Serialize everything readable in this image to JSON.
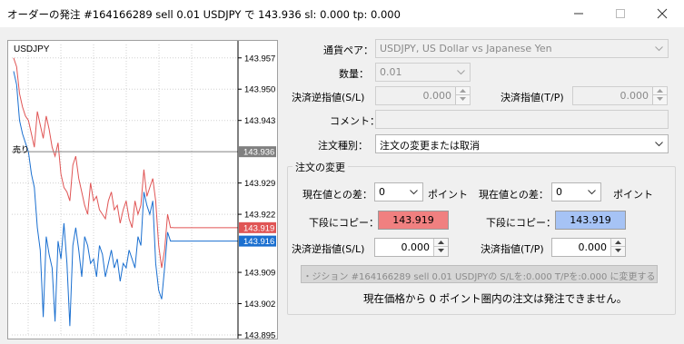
{
  "window": {
    "title": "オーダーの発注 #164166289 sell 0.01 USDJPY で 143.936 sl: 0.000 tp: 0.000"
  },
  "chart": {
    "symbol": "USDJPY",
    "axis_labels": [
      "143.957",
      "143.950",
      "143.943",
      "143.929",
      "143.922",
      "143.909",
      "143.902",
      "143.895"
    ],
    "current_price_tag": "143.936",
    "ask_tag": "143.919",
    "bid_tag": "143.916",
    "order_line_label": "売り"
  },
  "form": {
    "symbol_label": "通貨ペア：",
    "symbol_value": "USDJPY, US Dollar vs Japanese Yen",
    "volume_label": "数量：",
    "volume_value": "0.01",
    "sl_label": "決済逆指値(S/L)",
    "sl_value": "0.000",
    "tp_label": "決済指値(T/P)",
    "tp_value": "0.000",
    "comment_label": "コメント：",
    "comment_value": "",
    "type_label": "注文種別：",
    "type_value": "注文の変更または取消"
  },
  "modify": {
    "group_title": "注文の変更",
    "left": {
      "diff_label": "現在値との差：",
      "diff_value": "0",
      "points": "ポイント",
      "copy_label": "下段にコピー：",
      "copy_value": "143.919",
      "sl_label": "決済逆指値(S/L)",
      "sl_value": "0.000"
    },
    "right": {
      "diff_label": "現在値との差：",
      "diff_value": "0",
      "points": "ポイント",
      "copy_label": "下段にコピー：",
      "copy_value": "143.919",
      "tp_label": "決済指値(T/P)",
      "tp_value": "0.000"
    },
    "modify_button": "・ジション #164166289 sell 0.01 USDJPYの S/Lを:0.000 T/Pを:0.000 に変更する",
    "notice": "現在価格から 0 ポイント圏内の注文は発注できません。"
  },
  "colors": {
    "ask_line": "#e05555",
    "bid_line": "#1a6fd0",
    "ask_button": "#f08080",
    "bid_button": "#a6c3f5"
  },
  "chart_data": {
    "type": "line",
    "series": [
      {
        "values": [
          143.957,
          143.955,
          143.949,
          143.946,
          143.944,
          143.943,
          143.94,
          143.937,
          143.945,
          143.942,
          143.939,
          143.944,
          143.941,
          143.937,
          143.935,
          143.938,
          143.931,
          143.928,
          143.927,
          143.925,
          143.933,
          143.935,
          143.93,
          143.927,
          143.924,
          143.922,
          143.929,
          143.925,
          143.926,
          143.923,
          143.922,
          143.921,
          143.925,
          143.927,
          143.923,
          143.924,
          143.92,
          143.923,
          143.925,
          143.921,
          143.919,
          143.925,
          143.922,
          143.924,
          143.932,
          143.926,
          143.928,
          143.93,
          143.925,
          143.915,
          143.91,
          143.914,
          143.922,
          143.919,
          143.919
        ]
      },
      {
        "values": [
          143.954,
          143.951,
          143.943,
          143.94,
          143.938,
          143.936,
          143.931,
          143.928,
          143.919,
          143.914,
          143.899,
          143.917,
          143.913,
          143.91,
          143.898,
          143.916,
          143.912,
          143.92,
          143.911,
          143.897,
          143.915,
          143.919,
          143.914,
          143.908,
          143.917,
          143.915,
          143.911,
          143.912,
          143.908,
          143.915,
          143.913,
          143.908,
          143.911,
          143.914,
          143.91,
          143.912,
          143.907,
          143.911,
          143.91,
          143.914,
          143.912,
          143.91,
          143.917,
          143.915,
          143.927,
          143.924,
          143.922,
          143.925,
          143.911,
          143.905,
          143.903,
          143.91,
          143.918,
          143.916,
          143.916
        ]
      }
    ],
    "ylim": [
      143.895,
      143.96
    ],
    "grid": true
  }
}
